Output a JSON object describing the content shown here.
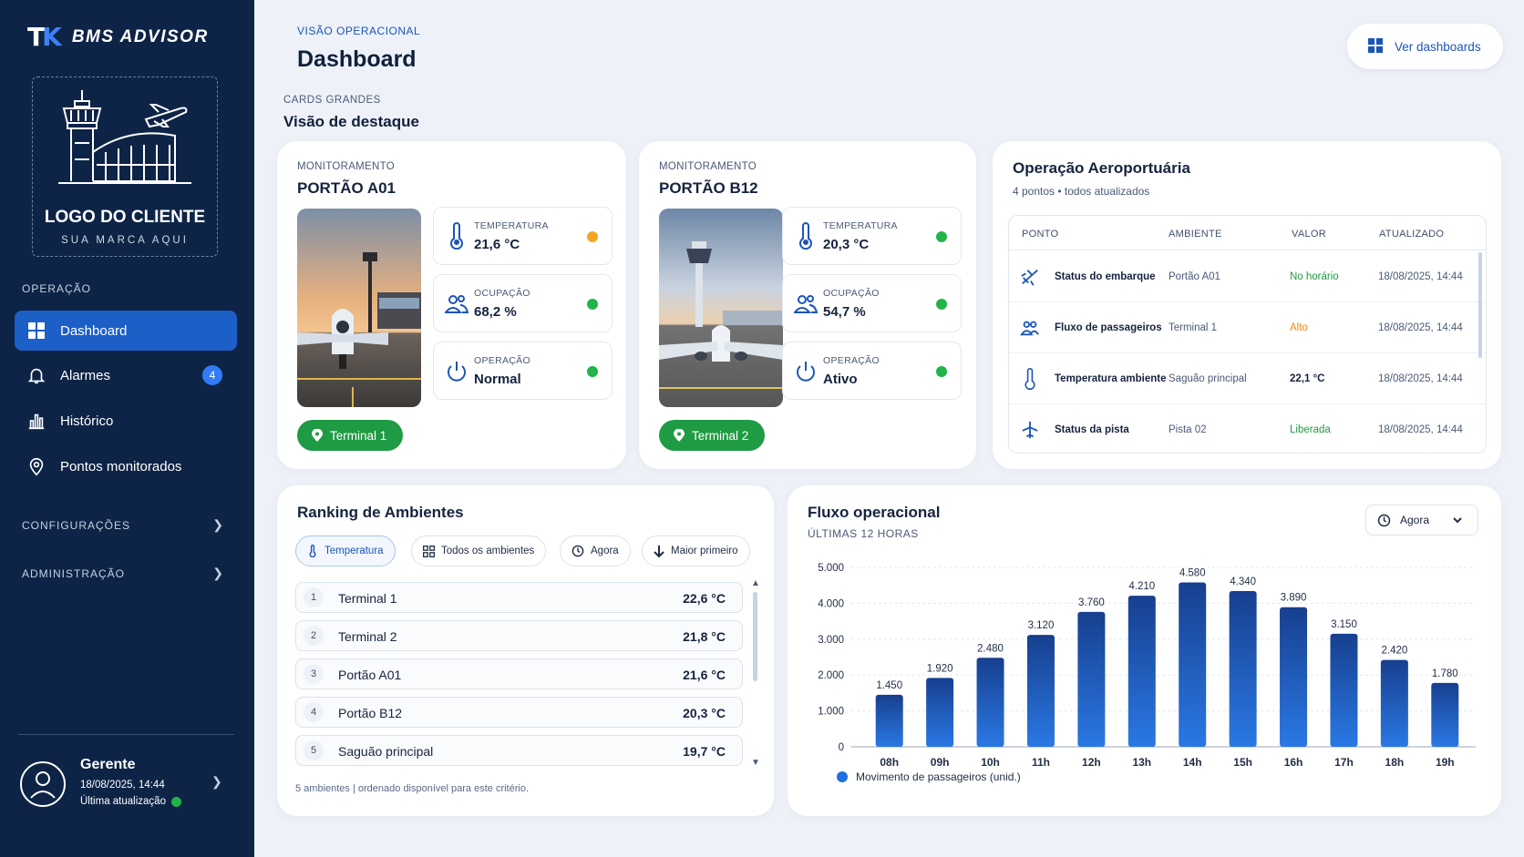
{
  "sidebar": {
    "brand_name": "BMS ADVISOR",
    "logo_title": "LOGO DO CLIENTE",
    "logo_subtitle": "SUA MARCA AQUI",
    "section_operacao": "OPERAÇÃO",
    "items": [
      {
        "label": "Dashboard",
        "icon": "grid-icon",
        "active": true
      },
      {
        "label": "Alarmes",
        "icon": "bell-icon",
        "badge": "4"
      },
      {
        "label": "Histórico",
        "icon": "bar-chart-icon"
      },
      {
        "label": "Pontos monitorados",
        "icon": "location-pin-icon"
      }
    ],
    "section_config": "CONFIGURAÇÕES",
    "section_admin": "ADMINISTRAÇÃO",
    "user": {
      "name": "Gerente",
      "time": "18/08/2025, 14:44",
      "update": "Última atualização"
    }
  },
  "header": {
    "kicker": "VISÃO OPERACIONAL",
    "title": "Dashboard",
    "button": "Ver dashboards",
    "section_kicker": "CARDS GRANDES",
    "section_title": "Visão de destaque"
  },
  "monitors": [
    {
      "kicker": "MONITORAMENTO",
      "title": "PORTÃO A01",
      "terminal": "Terminal 1",
      "metrics": [
        {
          "label": "TEMPERATURA",
          "value": "21,6 °C",
          "status_color": "#f5a524"
        },
        {
          "label": "OCUPAÇÃO",
          "value": "68,2 %",
          "status_color": "#22b34a"
        },
        {
          "label": "OPERAÇÃO",
          "value": "Normal",
          "status_color": "#22b34a"
        }
      ]
    },
    {
      "kicker": "MONITORAMENTO",
      "title": "PORTÃO B12",
      "terminal": "Terminal 2",
      "metrics": [
        {
          "label": "TEMPERATURA",
          "value": "20,3 °C",
          "status_color": "#22b34a"
        },
        {
          "label": "OCUPAÇÃO",
          "value": "54,7 %",
          "status_color": "#22b34a"
        },
        {
          "label": "OPERAÇÃO",
          "value": "Ativo",
          "status_color": "#22b34a"
        }
      ]
    }
  ],
  "operacao": {
    "title": "Operação Aeroportuária",
    "subtitle": "4 pontos • todos atualizados",
    "columns": [
      "PONTO",
      "AMBIENTE",
      "VALOR",
      "ATUALIZADO"
    ],
    "rows": [
      {
        "icon": "plane-takeoff-icon",
        "ponto": "Status do embarque",
        "ambiente": "Portão A01",
        "valor": "No horário",
        "valor_color": "#1f9b43",
        "atualizado": "18/08/2025, 14:44"
      },
      {
        "icon": "people-group-icon",
        "ponto": "Fluxo de passageiros",
        "ambiente": "Terminal 1",
        "valor": "Alto",
        "valor_color": "#f08a1c",
        "atualizado": "18/08/2025, 14:44"
      },
      {
        "icon": "thermometer-icon",
        "ponto": "Temperatura ambiente",
        "ambiente": "Saguão principal",
        "valor": "22,1 °C",
        "valor_color": "#16233f",
        "atualizado": "18/08/2025, 14:44"
      },
      {
        "icon": "plane-icon",
        "ponto": "Status da pista",
        "ambiente": "Pista 02",
        "valor": "Liberada",
        "valor_color": "#1f9b43",
        "atualizado": "18/08/2025, 14:44"
      }
    ]
  },
  "ranking": {
    "title": "Ranking de Ambientes",
    "chips": [
      "Temperatura",
      "Todos os ambientes",
      "Agora",
      "Maior primeiro"
    ],
    "rows": [
      {
        "rank": "1",
        "name": "Terminal 1",
        "value": "22,6 °C"
      },
      {
        "rank": "2",
        "name": "Terminal 2",
        "value": "21,8 °C"
      },
      {
        "rank": "3",
        "name": "Portão A01",
        "value": "21,6 °C"
      },
      {
        "rank": "4",
        "name": "Portão B12",
        "value": "20,3 °C"
      },
      {
        "rank": "5",
        "name": "Saguão principal",
        "value": "19,7 °C"
      }
    ],
    "footer": "5 ambientes | ordenado disponível para este critério."
  },
  "fluxo": {
    "title": "Fluxo operacional",
    "subtitle": "ÚLTIMAS 12 HORAS",
    "select": "Agora"
  },
  "chart_data": {
    "type": "bar",
    "title": "Fluxo operacional",
    "subtitle": "ÚLTIMAS 12 HORAS",
    "categories": [
      "08h",
      "09h",
      "10h",
      "11h",
      "12h",
      "13h",
      "14h",
      "15h",
      "16h",
      "17h",
      "18h",
      "19h"
    ],
    "series": [
      {
        "name": "Movimento de passageiros (unid.)",
        "values": [
          1450,
          1920,
          2480,
          3120,
          3760,
          4210,
          4580,
          4340,
          3890,
          3150,
          2420,
          1780
        ]
      }
    ],
    "value_labels": [
      "1.450",
      "1.920",
      "2.480",
      "3.120",
      "3.760",
      "4.210",
      "4.580",
      "4.340",
      "3.890",
      "3.150",
      "2.420",
      "1.780"
    ],
    "yticks": [
      "0",
      "1.000",
      "2.000",
      "3.000",
      "4.000",
      "5.000"
    ],
    "ylim": [
      0,
      5000
    ],
    "grid": true,
    "legend": "bottom-left",
    "color": "#1f6fe0"
  }
}
